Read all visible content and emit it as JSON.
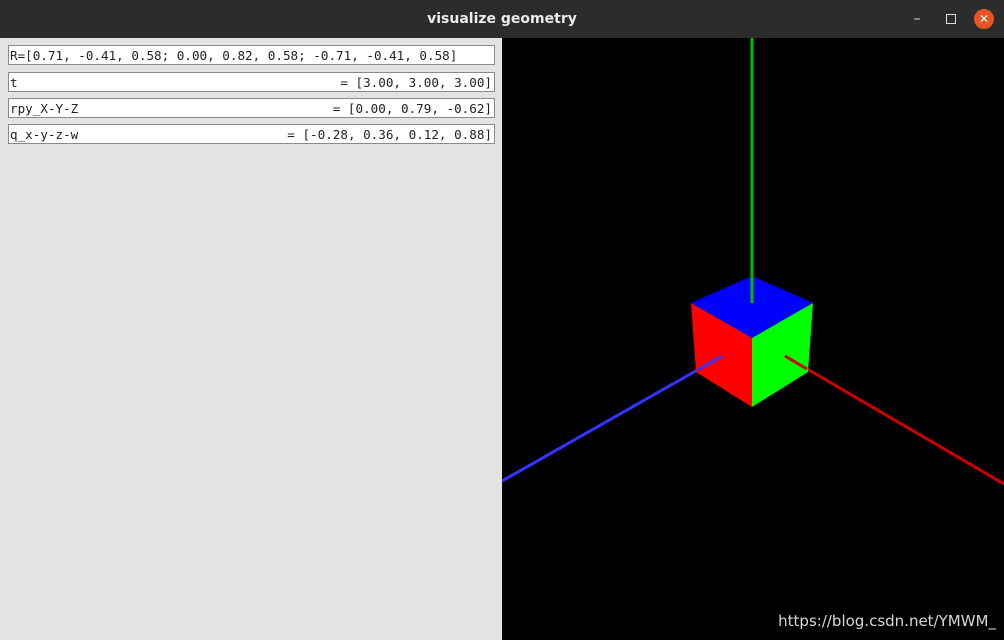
{
  "window": {
    "title": "visualize geometry"
  },
  "panel": {
    "rows": [
      {
        "text": "R=[0.71, -0.41, 0.58; 0.00, 0.82, 0.58; -0.71, -0.41, 0.58]"
      },
      {
        "label": "t",
        "value": "= [3.00, 3.00, 3.00]"
      },
      {
        "label": "rpy_X-Y-Z",
        "value": "= [0.00, 0.79, -0.62]"
      },
      {
        "label": "q_x-y-z-w",
        "value": "= [-0.28, 0.36, 0.12, 0.88]"
      }
    ]
  },
  "viewport": {
    "watermark": "https://blog.csdn.net/YMWM_",
    "colors": {
      "x_axis": "#cc0000",
      "y_axis": "#00bb00",
      "z_axis": "#3333ff",
      "cube_top": "#0000ff",
      "cube_left": "#ff0000",
      "cube_right": "#00ff00"
    }
  }
}
